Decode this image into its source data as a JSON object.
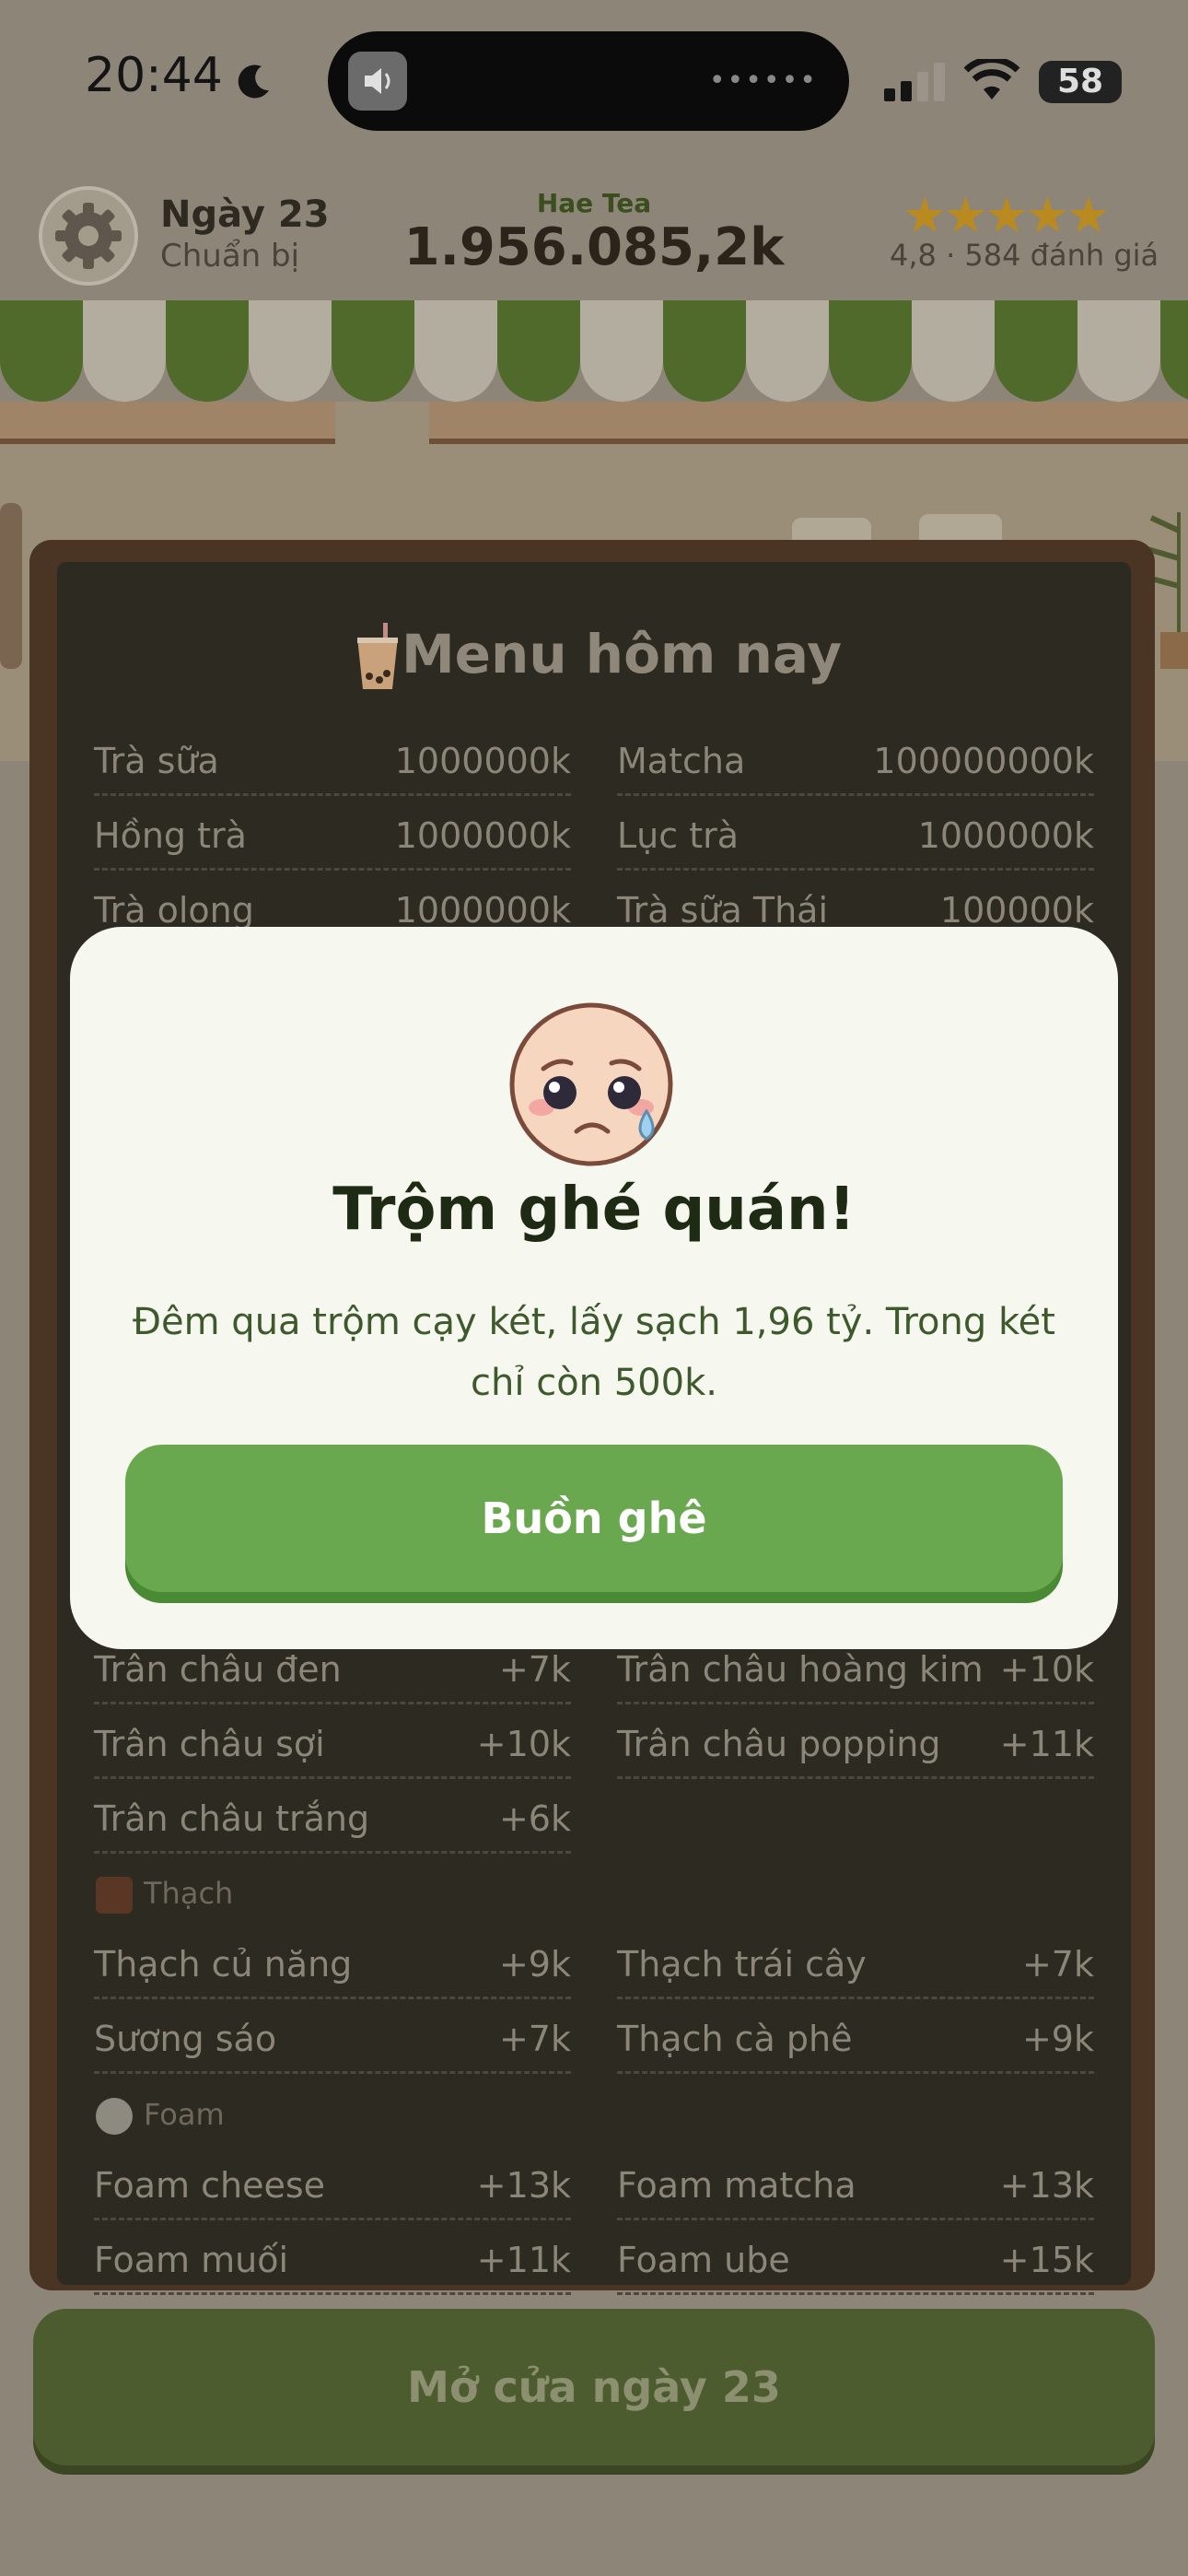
{
  "status_bar": {
    "time": "20:44",
    "battery": "58"
  },
  "header": {
    "day_title": "Ngày 23",
    "day_status": "Chuẩn bị",
    "shop_name": "Hae Tea",
    "money": "1.956.085,2k",
    "rating_stars": 5,
    "rating_text": "4,8 · 584 đánh giá"
  },
  "sign": {
    "name": "Hae Tea"
  },
  "menu": {
    "title": "Menu hôm nay",
    "drinks": [
      {
        "name": "Trà sữa",
        "price": "1000000k"
      },
      {
        "name": "Matcha",
        "price": "100000000k"
      },
      {
        "name": "Hồng trà",
        "price": "1000000k"
      },
      {
        "name": "Lục trà",
        "price": "1000000k"
      },
      {
        "name": "Trà olong",
        "price": "1000000k"
      },
      {
        "name": "Trà sữa Thái",
        "price": "100000k"
      }
    ],
    "pearls": [
      {
        "name": "Trân châu đen",
        "price": "+7k"
      },
      {
        "name": "Trân châu hoàng kim",
        "price": "+10k"
      },
      {
        "name": "Trân châu sợi",
        "price": "+10k"
      },
      {
        "name": "Trân châu popping",
        "price": "+11k"
      },
      {
        "name": "Trân châu trắng",
        "price": "+6k"
      }
    ],
    "jelly_section": "Thạch",
    "jelly": [
      {
        "name": "Thạch củ năng",
        "price": "+9k"
      },
      {
        "name": "Thạch trái cây",
        "price": "+7k"
      },
      {
        "name": "Sương sáo",
        "price": "+7k"
      },
      {
        "name": "Thạch cà phê",
        "price": "+9k"
      }
    ],
    "foam_section": "Foam",
    "foam": [
      {
        "name": "Foam cheese",
        "price": "+13k"
      },
      {
        "name": "Foam matcha",
        "price": "+13k"
      },
      {
        "name": "Foam muối",
        "price": "+11k"
      },
      {
        "name": "Foam ube",
        "price": "+15k"
      }
    ]
  },
  "open_button": "Mở cửa ngày 23",
  "modal": {
    "title": "Trộm ghé quán!",
    "message": "Đêm qua trộm cạy két, lấy sạch 1,96 tỷ. Trong két chỉ còn 500k.",
    "button": "Buồn ghê"
  },
  "colors": {
    "awning_green": "#4f6a2b",
    "awning_white": "#b3ad9f",
    "modal_button": "#6aa84f",
    "board": "#2d2a22"
  }
}
